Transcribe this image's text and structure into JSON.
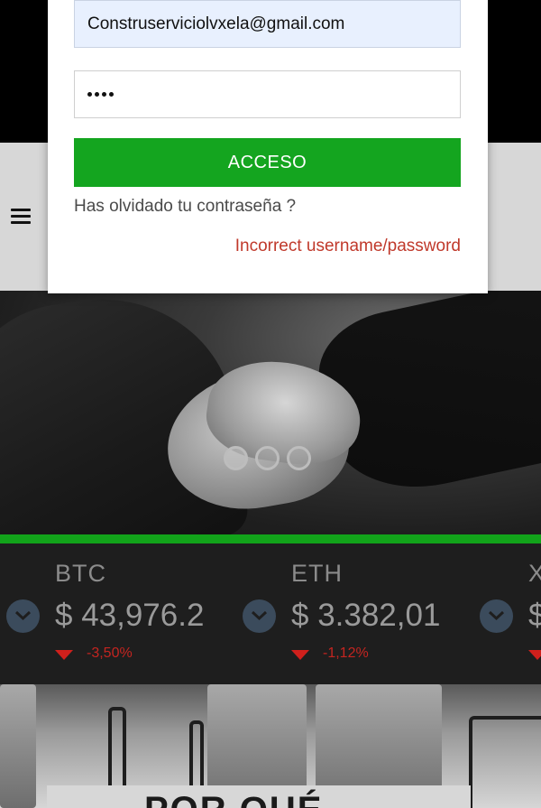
{
  "login": {
    "email_value": "Construserviciolvxela@gmail.com",
    "password_masked": "••••",
    "submit_label": "ACCESO",
    "forgot_label": "Has olvidado tu contraseña ?",
    "error_message": "Incorrect username/password"
  },
  "header": {
    "menu_icon": "hamburger-menu-icon"
  },
  "carousel": {
    "slide_count": 3
  },
  "ticker": [
    {
      "symbol": "BTC",
      "price": "$ 43,976.2",
      "change": "-3,50%",
      "direction": "down"
    },
    {
      "symbol": "ETH",
      "price": "$ 3.382,01",
      "change": "-1,12%",
      "direction": "down"
    },
    {
      "symbol": "X",
      "price": "$",
      "change": "",
      "direction": "down"
    }
  ],
  "section": {
    "title": "POR QUÉ"
  },
  "colors": {
    "accent_green": "#14a51f",
    "error_red": "#c0392b",
    "down_red": "#d0201c"
  }
}
